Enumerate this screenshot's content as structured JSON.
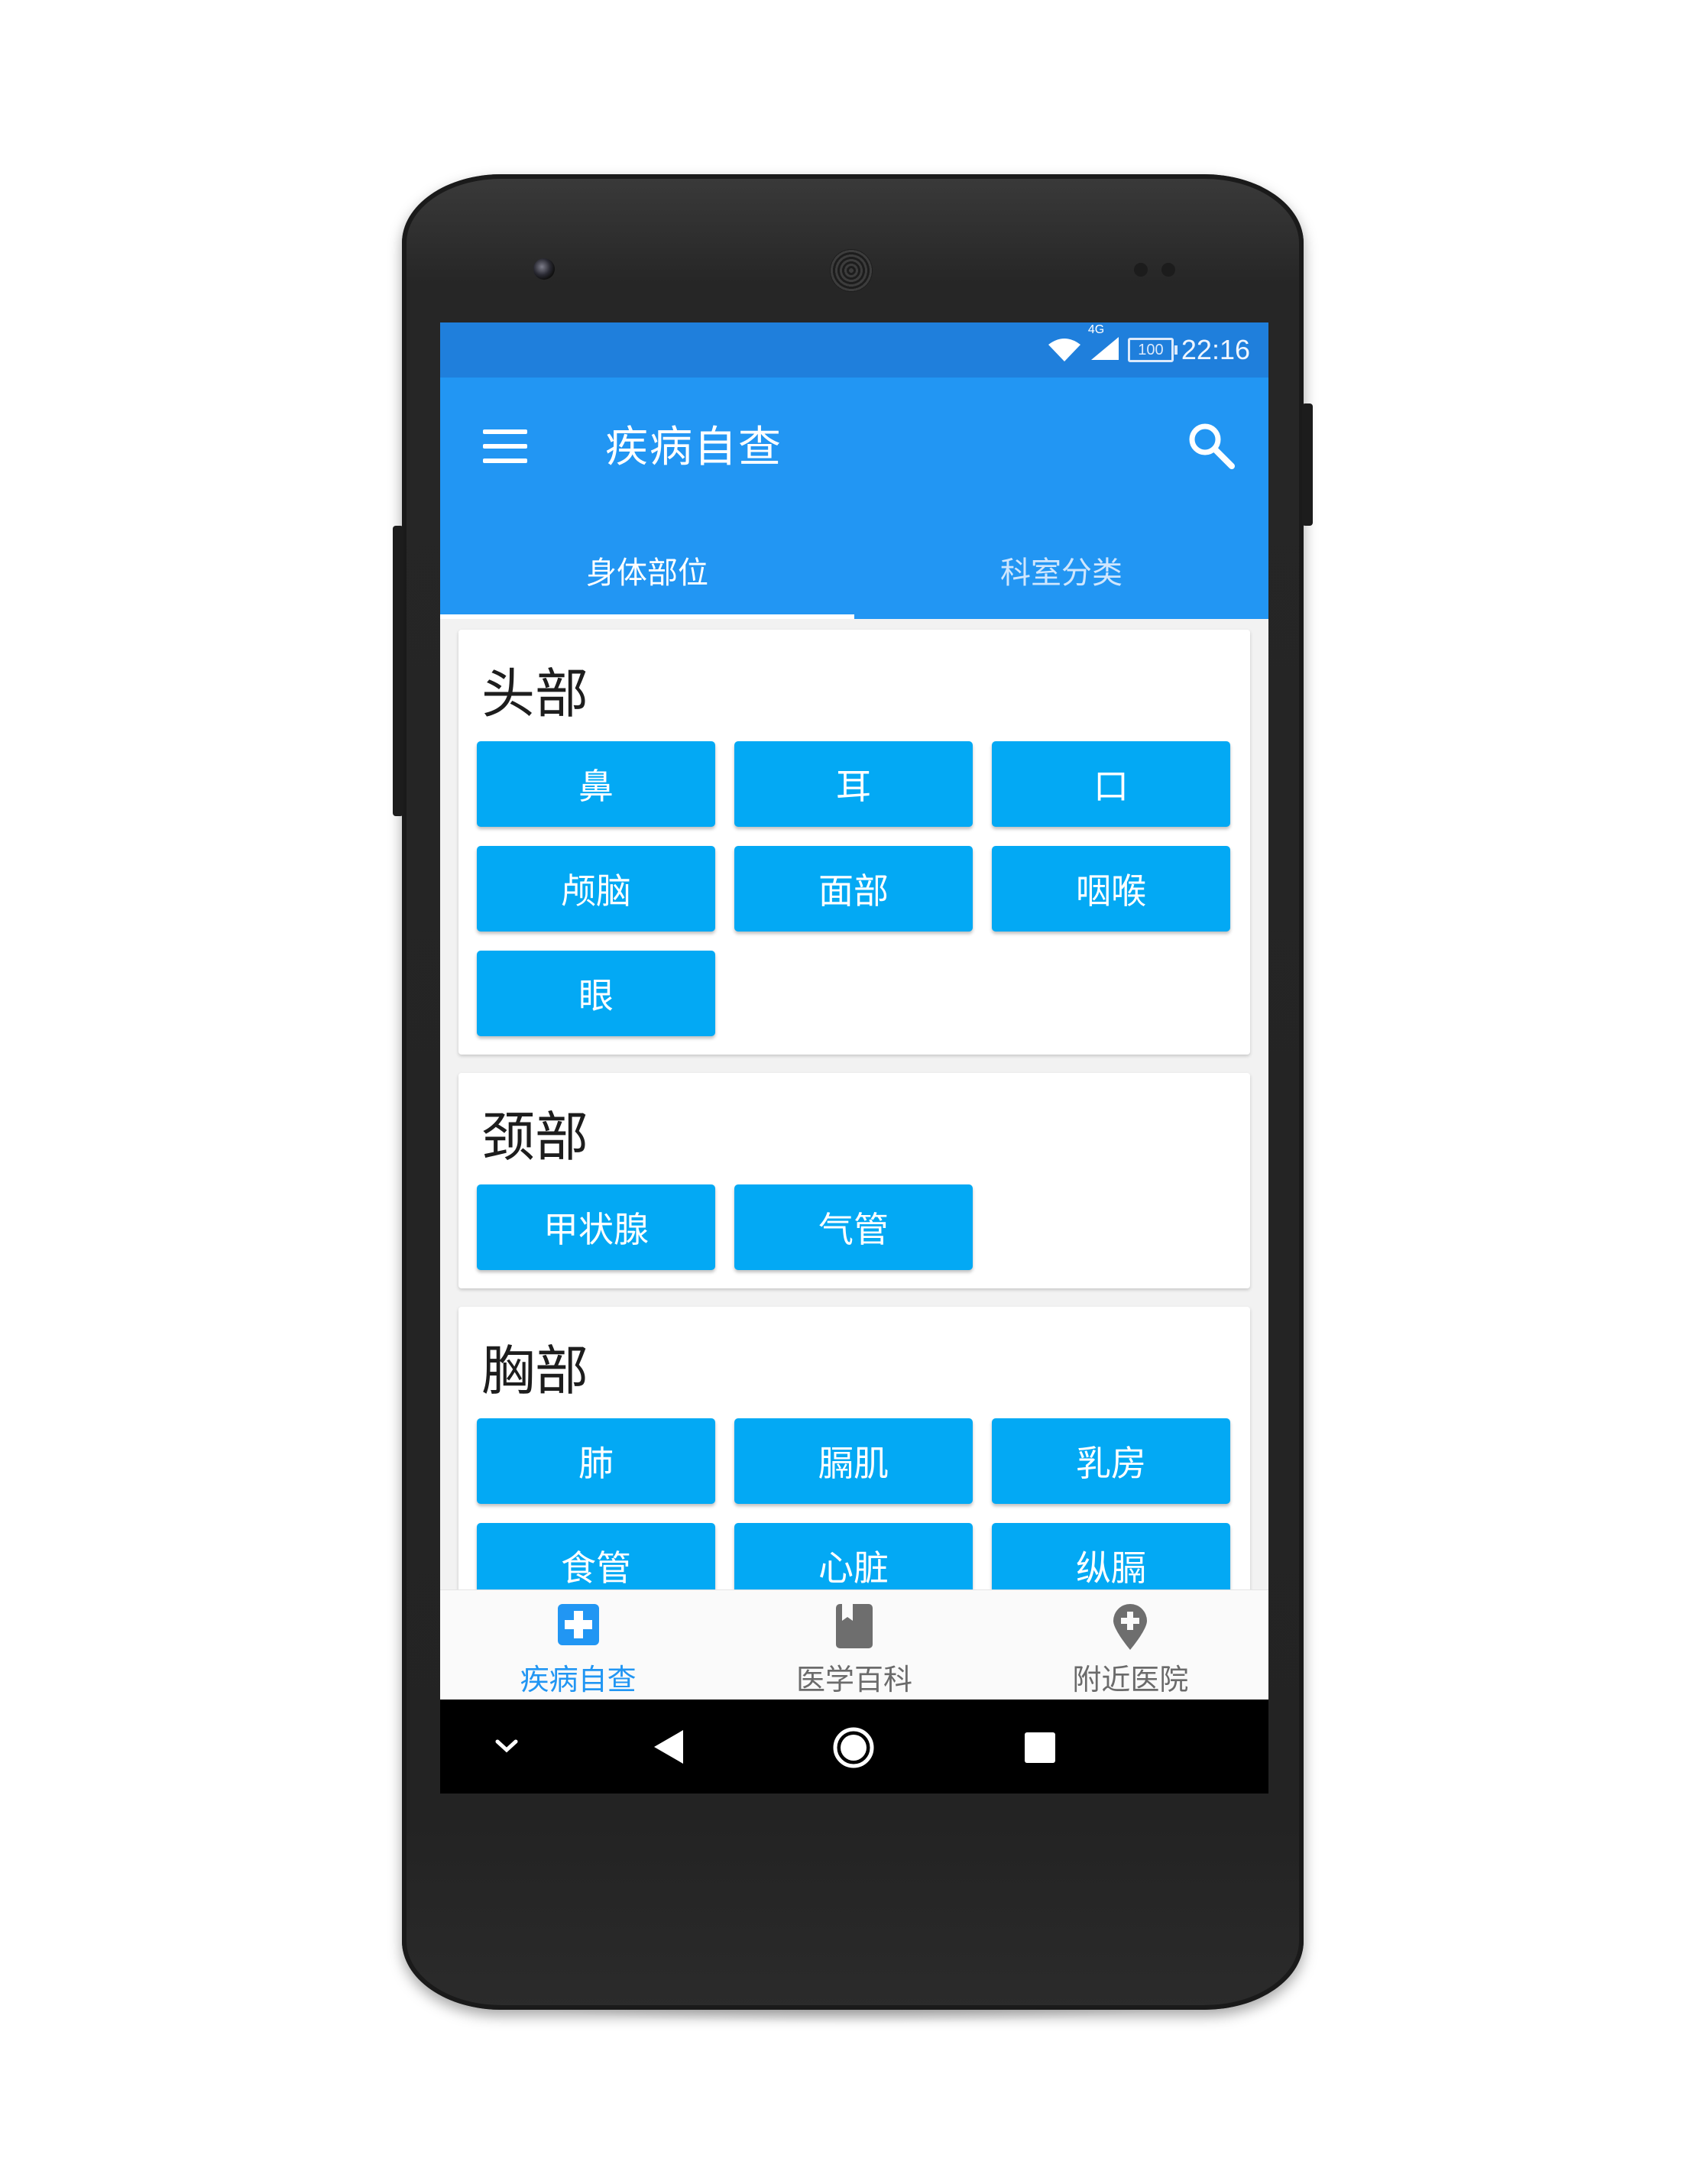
{
  "status_bar": {
    "network": "4G",
    "battery": "100",
    "time": "22:16"
  },
  "app_bar": {
    "title": "疾病自查"
  },
  "tabs": [
    {
      "label": "身体部位",
      "active": true
    },
    {
      "label": "科室分类",
      "active": false
    }
  ],
  "sections": [
    {
      "title": "头部",
      "items": [
        "鼻",
        "耳",
        "口",
        "颅脑",
        "面部",
        "咽喉",
        "眼"
      ]
    },
    {
      "title": "颈部",
      "items": [
        "甲状腺",
        "气管"
      ]
    },
    {
      "title": "胸部",
      "items": [
        "肺",
        "膈肌",
        "乳房",
        "食管",
        "心脏",
        "纵膈"
      ]
    }
  ],
  "bottom_nav": [
    {
      "label": "疾病自查",
      "icon": "medical-cross-icon",
      "active": true
    },
    {
      "label": "医学百科",
      "icon": "book-icon",
      "active": false
    },
    {
      "label": "附近医院",
      "icon": "location-pin-icon",
      "active": false
    }
  ],
  "colors": {
    "status_bar": "#1f7fdc",
    "app_bar": "#2296f3",
    "chip": "#03a9f4",
    "active_nav": "#2196f3"
  }
}
